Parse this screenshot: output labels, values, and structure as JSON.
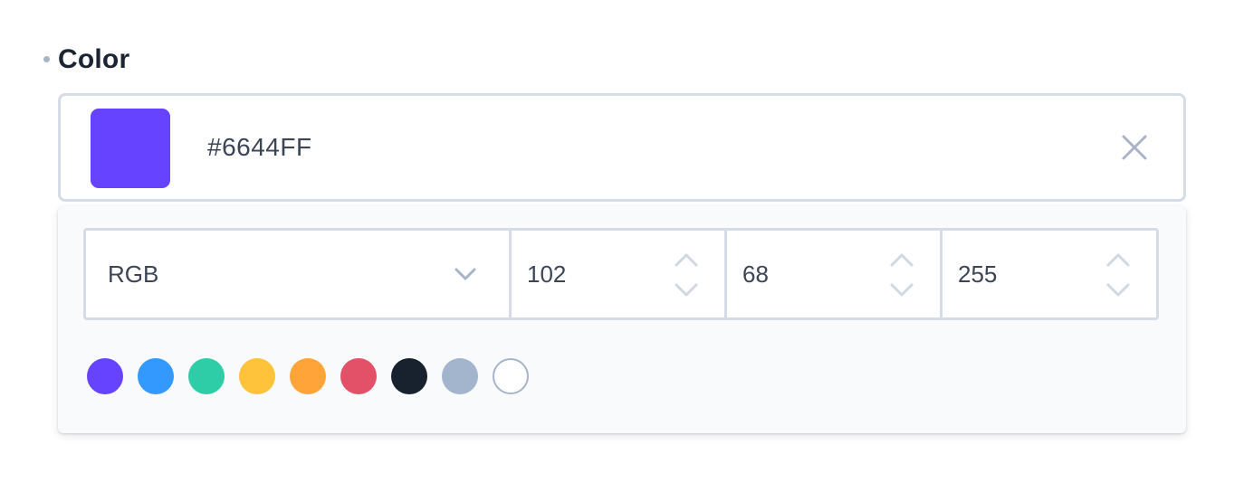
{
  "field": {
    "label": "Color"
  },
  "color_input": {
    "value": "#6644FF",
    "preview_color": "#6644FF",
    "clear_icon": "close-icon"
  },
  "picker": {
    "mode": "RGB",
    "mode_icon": "chevron-down-icon",
    "channels": [
      {
        "value": "102"
      },
      {
        "value": "68"
      },
      {
        "value": "255"
      }
    ],
    "presets": [
      {
        "color": "#6644FF"
      },
      {
        "color": "#3399FF"
      },
      {
        "color": "#2ECDA7"
      },
      {
        "color": "#FFC23B"
      },
      {
        "color": "#FFA439"
      },
      {
        "color": "#E35169"
      },
      {
        "color": "#18222F"
      },
      {
        "color": "#A2B5CD"
      },
      {
        "color": "#FFFFFF"
      }
    ]
  },
  "colors": {
    "border": "#d5dce6",
    "icon": "#a8b5c8",
    "text": "#3b4556",
    "label": "#1b2433",
    "popover_bg": "#f8fafc"
  }
}
